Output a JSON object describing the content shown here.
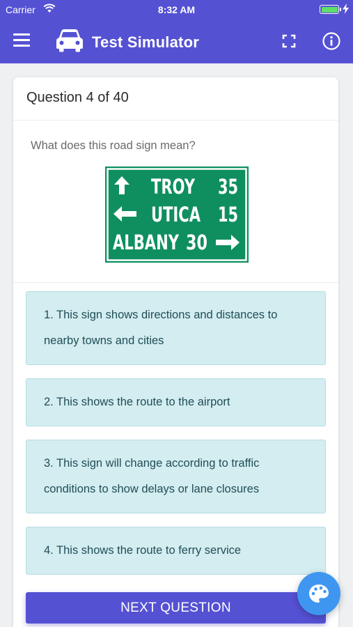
{
  "status_bar": {
    "carrier": "Carrier",
    "time": "8:32 AM",
    "battery_color": "#5ee06a"
  },
  "app_bar": {
    "title": "Test Simulator",
    "background": "#5551d3",
    "icons": [
      "menu-icon",
      "car-icon",
      "fullscreen-icon",
      "info-icon"
    ]
  },
  "question": {
    "header": "Question 4 of 40",
    "text": "What does this road sign mean?",
    "sign": {
      "rows": [
        {
          "arrow": "up-arrow",
          "place": "TROY",
          "distance": "35"
        },
        {
          "arrow": "left-arrow",
          "place": "UTICA",
          "distance": "15"
        },
        {
          "arrow": "right-arrow",
          "place": "ALBANY",
          "distance": "30"
        }
      ],
      "color": "#0f8f5f"
    }
  },
  "answers": [
    {
      "label": "1. This sign shows directions and distances to nearby towns and cities"
    },
    {
      "label": "2. This shows the route to the airport"
    },
    {
      "label": "3. This sign will change according to traffic conditions to show delays or lane closures"
    },
    {
      "label": "4. This shows the route to ferry service"
    }
  ],
  "next_button": {
    "label": "NEXT QUESTION"
  },
  "fab": {
    "icon": "palette-icon",
    "color": "#3f96f0"
  }
}
